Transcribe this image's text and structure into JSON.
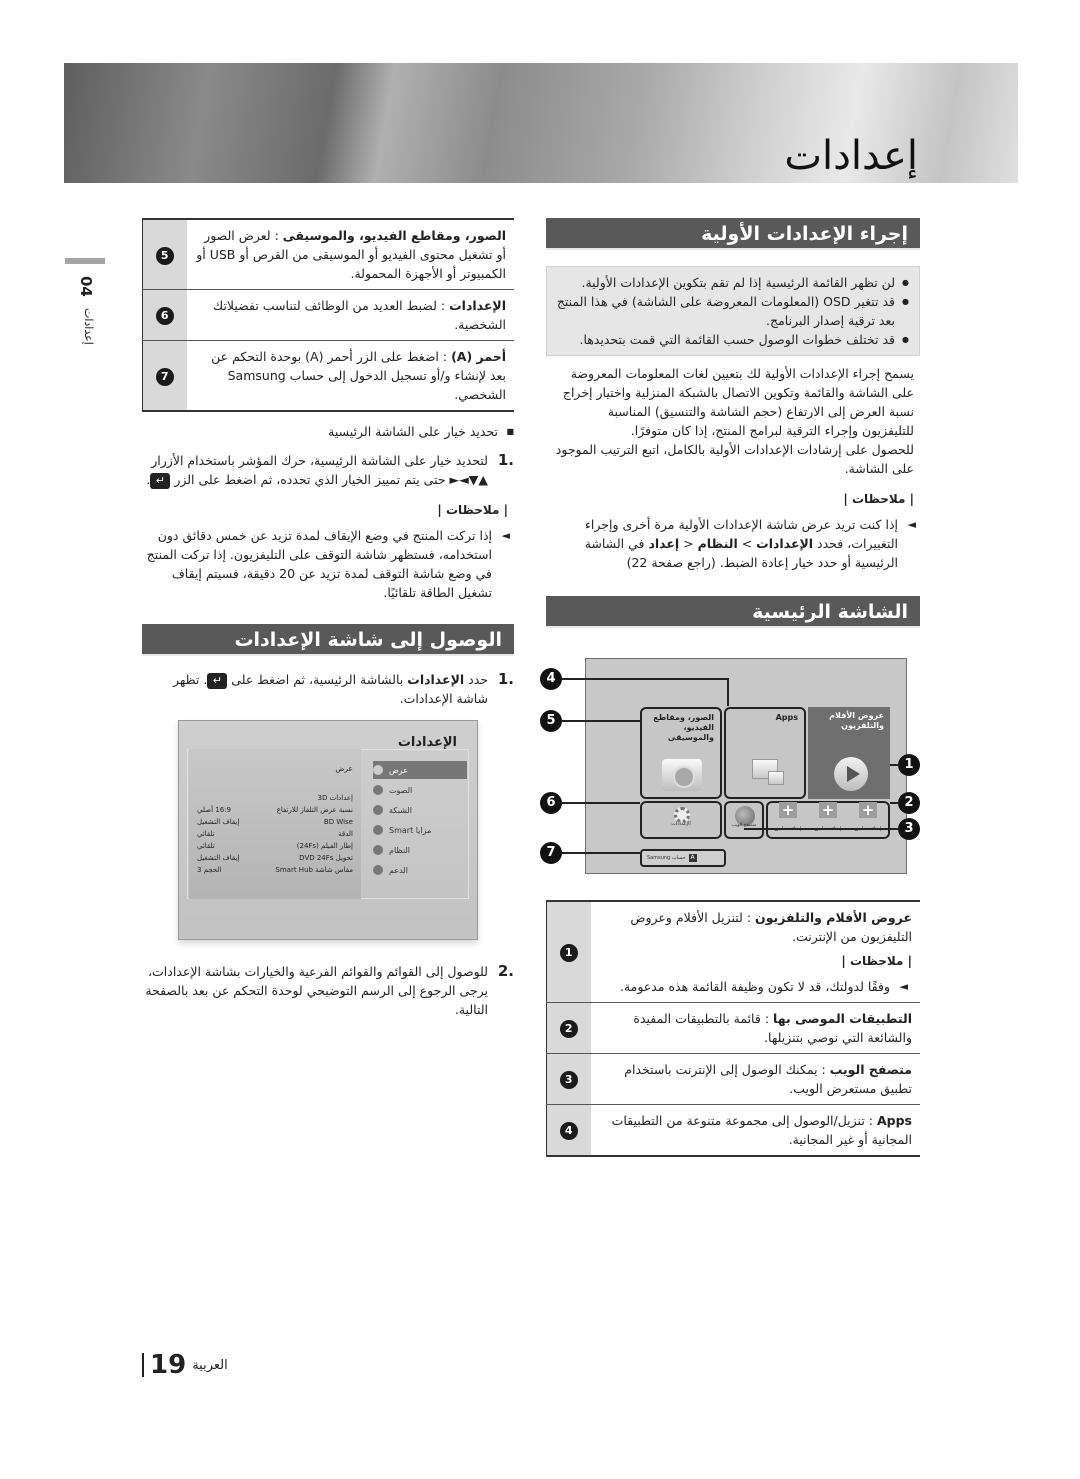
{
  "header": {
    "title": "إعدادات"
  },
  "side_tab": {
    "chapter": "04",
    "label": "إعدادات"
  },
  "initial_settings": {
    "heading": "إجراء الإعدادات الأولية",
    "bullets": [
      "لن تظهر القائمة الرئيسية إذا لم تقم بتكوين الإعدادات الأولية.",
      "قد تتغير OSD (المعلومات المعروضة على الشاشة) في هذا المنتج بعد ترقية إصدار البرنامج.",
      "قد تختلف خطوات الوصول حسب القائمة التي قمت بتحديدها."
    ],
    "paragraph1": "يسمح إجراء الإعدادات الأولية لك بتعيين لغات المعلومات المعروضة على الشاشة والقائمة وتكوين الاتصال بالشبكة المنزلية واختيار إخراج نسبة العرض إلى الارتفاع (حجم الشاشة والتنسيق) المناسبة للتليفزيون وإجراء الترقية لبرامج المنتج، إذا كان متوفرًا.",
    "paragraph2": "للحصول على إرشادات الإعدادات الأولية بالكامل، اتبع الترتيب الموجود على الشاشة.",
    "notes_label": "| ملاحظات |",
    "note_parts": {
      "a": "إذا كنت تريد عرض شاشة الإعدادات الأولية مرة أخرى وإجراء التغييرات، فحدد ",
      "b": "الإعدادات",
      "c": " > ",
      "d": "النظام",
      "e": " < ",
      "f": "إعداد",
      "g": " في الشاشة الرئيسية أو حدد خيار إعادة الضبط. (راجع صفحة 22)"
    }
  },
  "home_screen": {
    "heading": "الشاشة الرئيسية",
    "tiles": {
      "movies_tv": "عروض الأفلام والتلفزيون",
      "apps": "Apps",
      "photos_videos_music": "الصور، ومقاطع الفيديو، والموسيقى",
      "settings": "الإعدادات",
      "web_browser": "متصفح الويب",
      "add_app": "إضافة تطبيق",
      "samsung_account": "حساب Samsung",
      "a_key": "A"
    },
    "callouts": [
      "1",
      "2",
      "3",
      "4",
      "5",
      "6",
      "7"
    ]
  },
  "items_table_right": [
    {
      "num": "1",
      "title": "عروض الأفلام والتلفزيون",
      "sep": " : ",
      "text": "لتنزيل الأفلام وعروض التليفزيون من الإنترنت.",
      "notes_label": "| ملاحظات |",
      "note": "وفقًا لدولتك، قد لا تكون وظيفة القائمة هذه مدعومة."
    },
    {
      "num": "2",
      "title": "التطبيقات الموصى بها",
      "sep": " : ",
      "text": "قائمة بالتطبيقات المفيدة والشائعة التي نوصي بتنزيلها."
    },
    {
      "num": "3",
      "title": "متصفح الويب",
      "sep": " : ",
      "text": "يمكنك الوصول إلى الإنترنت باستخدام تطبيق مستعرض الويب."
    },
    {
      "num": "4",
      "title": "Apps",
      "sep": " : ",
      "text": "تنزيل/الوصول إلى مجموعة متنوعة من التطبيقات المجانية أو غير المجانية."
    }
  ],
  "items_table_left": [
    {
      "num": "5",
      "title": "الصور، ومقاطع الفيديو، والموسيقى",
      "sep": " : ",
      "text": "لعرض الصور أو تشغيل محتوى الفيديو أو الموسيقى من القرص أو USB أو الكمبيوتر أو الأجهزة المحمولة."
    },
    {
      "num": "6",
      "title": "الإعدادات",
      "sep": " : ",
      "text": "لضبط العديد من الوظائف لتناسب تفضيلاتك الشخصية."
    },
    {
      "num": "7",
      "title": "أحمر (A)",
      "sep": " : ",
      "text": "اضغط على الزر أحمر (A) بوحدة التحكم عن بعد لإنشاء و/أو تسجيل الدخول إلى حساب Samsung الشخصي."
    }
  ],
  "select_option": {
    "bullet": "تحديد خيار على الشاشة الرئيسية",
    "step_num": "1.",
    "step_text": "لتحديد خيار على الشاشة الرئيسية، حرك المؤشر باستخدام الأزرار ▲▼◄► حتى يتم تمييز الخيار الذي تحدده، ثم اضغط على الزر",
    "notes_label": "| ملاحظات |",
    "note": "إذا تركت المنتج في وضع الإيقاف لمدة تزيد عن خمس دقائق دون استخدامه، فستظهر شاشة التوقف على التليفزيون. إذا تركت المنتج في وضع شاشة التوقف لمدة تزيد عن 20 دقيقة، فسيتم إيقاف تشغيل الطاقة تلقائيًا."
  },
  "access_settings": {
    "heading": "الوصول إلى شاشة الإعدادات",
    "step1_num": "1.",
    "step1_a": "حدد ",
    "step1_bold": "الإعدادات",
    "step1_b": " بالشاشة الرئيسية، ثم اضغط على ",
    "step1_c": ". تظهر شاشة الإعدادات.",
    "step2_num": "2.",
    "step2_text": "للوصول إلى القوائم والقوائم الفرعية والخيارات بشاشة الإعدادات، يرجى الرجوع إلى الرسم التوضيحي لوحدة التحكم عن بعد بالصفحة التالية."
  },
  "settings_screen": {
    "title": "الإعدادات",
    "menu": [
      "عرض",
      "الصوت",
      "الشبكة",
      "مزايا Smart",
      "النظام",
      "الدعم"
    ],
    "selected_menu": "عرض",
    "panel_header": "عرض",
    "rows": [
      {
        "key": "إعدادات 3D",
        "value": ""
      },
      {
        "key": "نسبة عرض التلفاز للارتفاع",
        "value": "16:9 أصلي"
      },
      {
        "key": "BD Wise",
        "value": "إيقاف التشغيل"
      },
      {
        "key": "الدقة",
        "value": "تلقائي"
      },
      {
        "key": "إطار الفيلم (24Fs)",
        "value": "تلقائي"
      },
      {
        "key": "تحويل DVD 24Fs",
        "value": "إيقاف التشغيل"
      },
      {
        "key": "مقاس شاشة Smart Hub",
        "value": "الحجم 3"
      }
    ]
  },
  "enter_key_glyph": "↵",
  "footer": {
    "language": "العربية",
    "page": "19"
  }
}
